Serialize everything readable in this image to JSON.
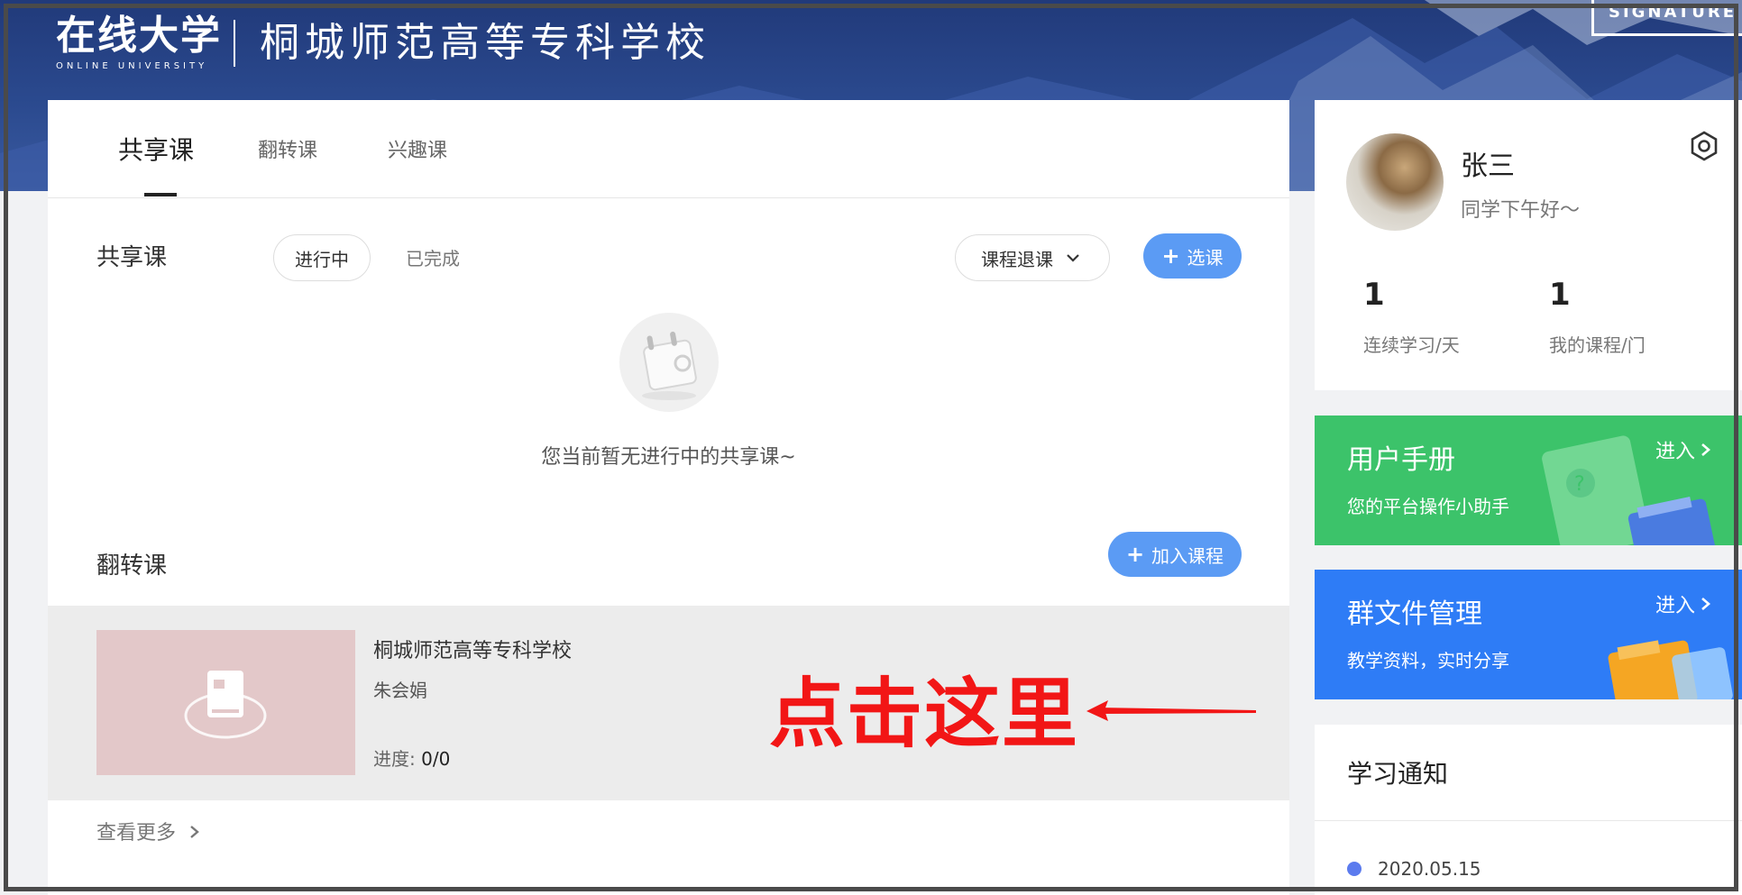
{
  "header": {
    "logo_cn": "在线大学",
    "logo_en": "ONLINE UNIVERSITY",
    "school_name": "桐城师范高等专科学校",
    "signature": "SIGNATURE"
  },
  "tabs": [
    {
      "label": "共享课",
      "active": true
    },
    {
      "label": "翻转课",
      "active": false
    },
    {
      "label": "兴趣课",
      "active": false
    }
  ],
  "shared": {
    "title": "共享课",
    "filter_in_progress": "进行中",
    "filter_done": "已完成",
    "drop_label": "课程退课",
    "select_label": "选课",
    "empty_text": "您当前暂无进行中的共享课~"
  },
  "flip": {
    "title": "翻转课",
    "add_label": "加入课程",
    "course": {
      "name": "桐城师范高等专科学校",
      "teacher": "朱会娟",
      "progress_label": "进度:",
      "progress_value": "0/0"
    },
    "annotation": "点击这里",
    "see_more": "查看更多"
  },
  "profile": {
    "name": "张三",
    "greeting": "同学下午好～",
    "stats": [
      {
        "value": "1",
        "label": "连续学习/天"
      },
      {
        "value": "1",
        "label": "我的课程/门"
      }
    ]
  },
  "cards": {
    "manual": {
      "title": "用户手册",
      "subtitle": "您的平台操作小助手",
      "enter": "进入"
    },
    "files": {
      "title": "群文件管理",
      "subtitle": "教学资料，实时分享",
      "enter": "进入"
    }
  },
  "notice": {
    "title": "学习通知",
    "items": [
      {
        "date": "2020.05.15"
      }
    ]
  },
  "colors": {
    "accent_blue": "#5b9bf4",
    "card_green": "#3cc36a",
    "card_blue": "#2e7cf6",
    "annotation_red": "#f21616"
  }
}
